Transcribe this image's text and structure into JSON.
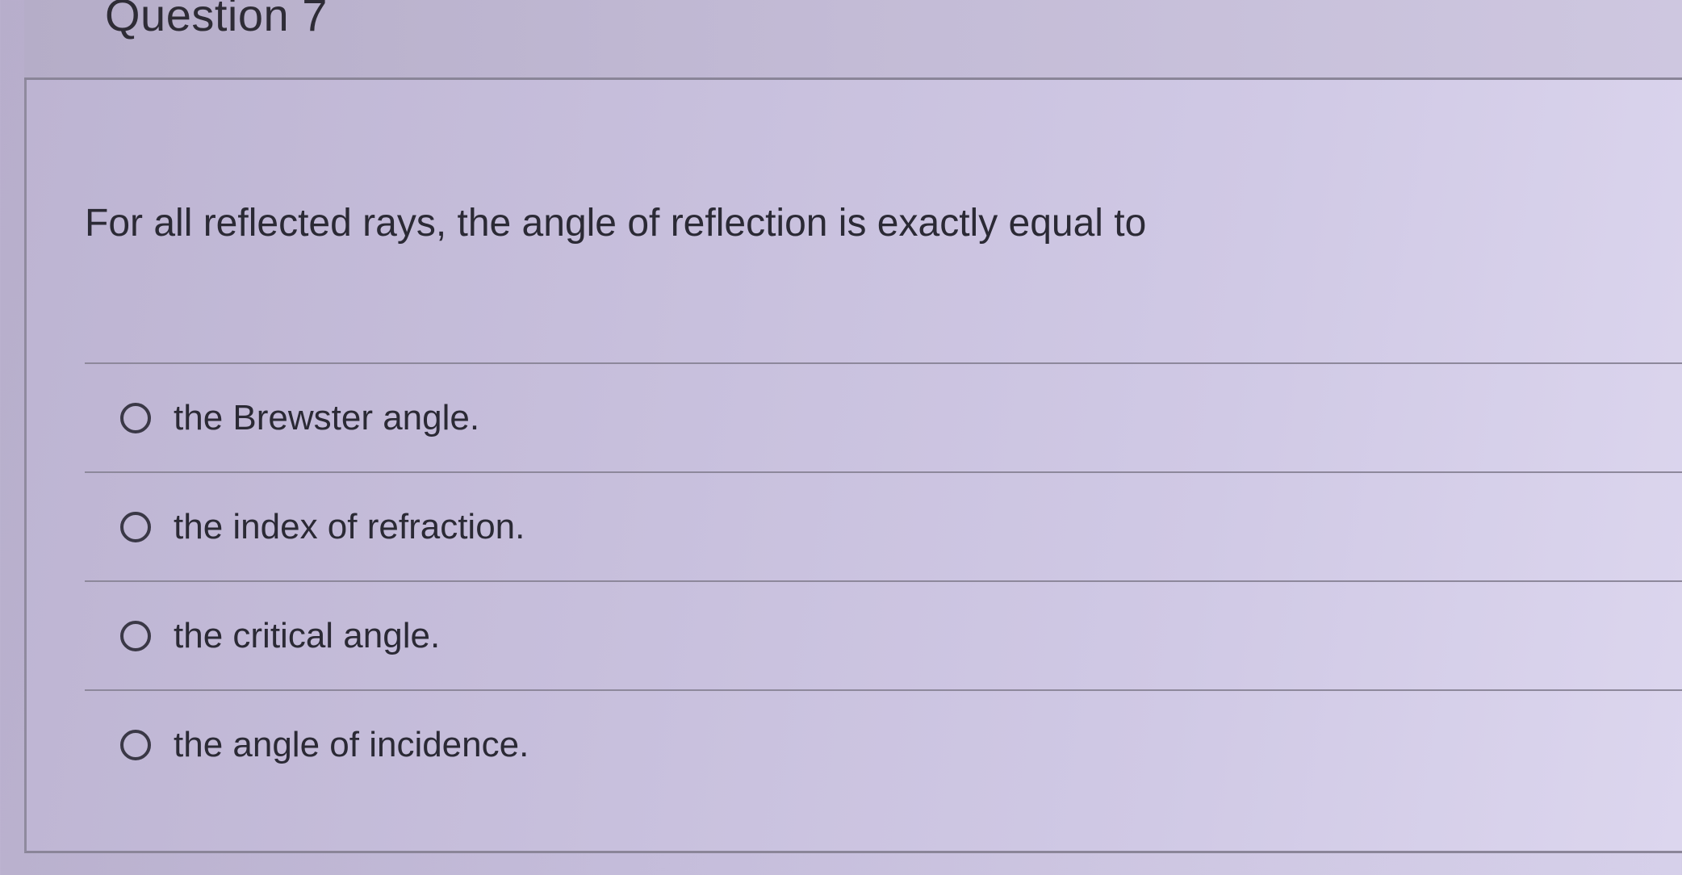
{
  "question": {
    "title": "Question 7",
    "text": "For all reflected rays, the angle of reflection is exactly equal to"
  },
  "options": [
    {
      "label": "the Brewster angle.",
      "selected": false
    },
    {
      "label": "the index of refraction.",
      "selected": false
    },
    {
      "label": "the critical angle.",
      "selected": false
    },
    {
      "label": "the angle of incidence.",
      "selected": false
    }
  ]
}
